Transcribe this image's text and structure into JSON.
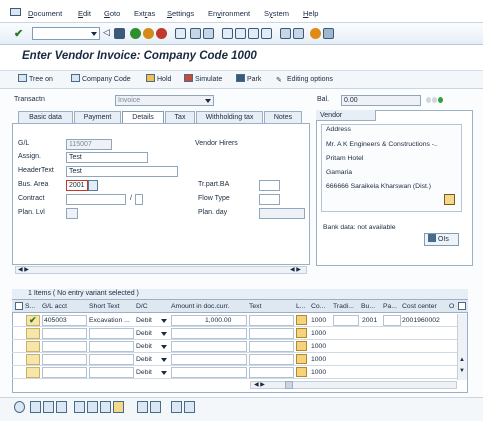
{
  "menu": [
    "Document",
    "Edit",
    "Goto",
    "Extras",
    "Settings",
    "Environment",
    "System",
    "Help"
  ],
  "menu_underline": [
    "D",
    "E",
    "G",
    "r",
    "S",
    "v",
    "y",
    "H"
  ],
  "page_title": "Enter Vendor Invoice: Company Code 1000",
  "app_toolbar": {
    "tree_on": "Tree on",
    "company_code": "Company Code",
    "hold": "Hold",
    "simulate": "Simulate",
    "park": "Park",
    "editing_options": "Editing options"
  },
  "header": {
    "transactn_label": "Transactn",
    "transactn_value": "Invoice",
    "bal_label": "Bal.",
    "bal_value": "0.00"
  },
  "tabs": [
    "Basic data",
    "Payment",
    "Details",
    "Tax",
    "Withholding tax",
    "Notes"
  ],
  "active_tab": "Details",
  "details": {
    "gl_label": "G/L",
    "gl_value": "115007",
    "vendor_hirers": "Vendor Hirers",
    "assign_label": "Assign.",
    "assign_value": "Test",
    "headertext_label": "HeaderText",
    "headertext_value": "Test",
    "busarea_label": "Bus. Area",
    "busarea_value": "2001",
    "trpart_label": "Tr.part.BA",
    "contract_label": "Contract",
    "contract_sep": "/",
    "flowtype_label": "Flow Type",
    "planlvl_label": "Plan. Lvl",
    "planday_label": "Plan. day"
  },
  "vendor": {
    "tab_label": "Vendor",
    "address_label": "Address",
    "lines": [
      "Mr. A K Engineers & Constructions -..",
      "Pritam Hotel",
      "Gamaria",
      "666666 Saraikela Kharswan (Dist.)"
    ],
    "bank_data": "Bank data: not available",
    "ois_label": "OIs"
  },
  "items": {
    "info": "1 Items ( No entry variant selected )",
    "columns": [
      "S...",
      "G/L acct",
      "Short Text",
      "D/C",
      "Amount in doc.curr.",
      "Text",
      "L...",
      "Co...",
      "Tradi...",
      "Bu...",
      "Pa...",
      "Cost center",
      "O"
    ],
    "rows": [
      {
        "gl": "405003",
        "short": "Excavation ...",
        "dc": "Debit",
        "amount": "1,000.00",
        "co": "1000",
        "bu": "2001",
        "cc": "2001960002"
      },
      {
        "gl": "",
        "short": "",
        "dc": "Debit",
        "amount": "",
        "co": "1000",
        "bu": "",
        "cc": ""
      },
      {
        "gl": "",
        "short": "",
        "dc": "Debit",
        "amount": "",
        "co": "1000",
        "bu": "",
        "cc": ""
      },
      {
        "gl": "",
        "short": "",
        "dc": "Debit",
        "amount": "",
        "co": "1000",
        "bu": "",
        "cc": ""
      },
      {
        "gl": "",
        "short": "",
        "dc": "Debit",
        "amount": "",
        "co": "1000",
        "bu": "",
        "cc": ""
      }
    ]
  },
  "colors": {
    "accent": "#1a2a40",
    "panel": "#e7eef5",
    "highlight": "#f6e7a8",
    "status_green": "#2fa33a"
  }
}
